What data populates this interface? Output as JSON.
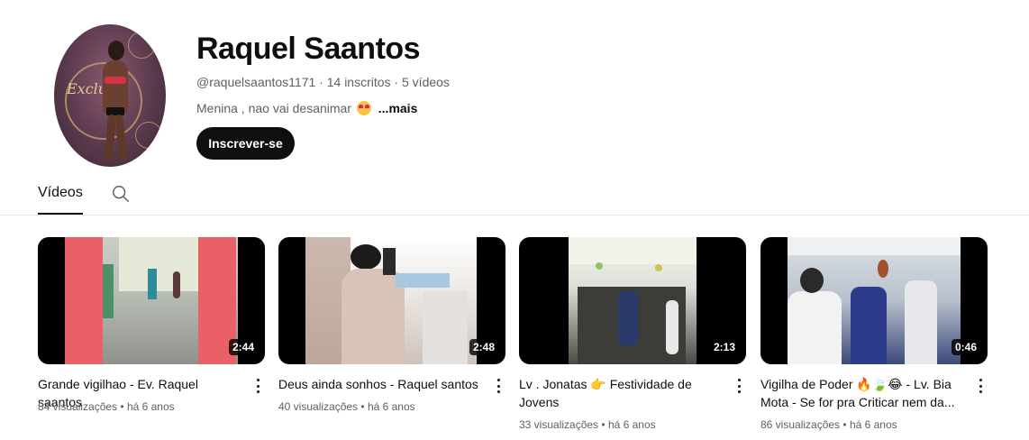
{
  "channel": {
    "name": "Raquel Saantos",
    "handle": "@raquelsaantos1171",
    "subscribers": "14 inscritos",
    "video_count": "5 vídeos",
    "separator": " · ",
    "description": "Menina , nao vai desanimar",
    "description_emoji": "star-struck-emoji",
    "more_label": "...mais",
    "subscribe_label": "Inscrever-se",
    "avatar_text": "Exclu"
  },
  "tabs": {
    "videos_label": "Vídeos",
    "search_icon": "search-icon"
  },
  "videos": [
    {
      "title": "Grande vigilhao - Ev. Raquel saantos",
      "views": "84 visualizações",
      "age": "há 6 anos",
      "duration": "2:44"
    },
    {
      "title": "Deus ainda sonhos - Raquel santos",
      "views": "40 visualizações",
      "age": "há 6 anos",
      "duration": "2:48"
    },
    {
      "title": "Lv . Jonatas 👉 Festividade de Jovens",
      "views": "33 visualizações",
      "age": "há 6 anos",
      "duration": "2:13"
    },
    {
      "title": "Vigilha de Poder 🔥🍃😂 - Lv. Bia Mota - Se for pra Criticar nem da...",
      "views": "86 visualizações",
      "age": "há 6 anos",
      "duration": "0:46"
    }
  ],
  "colors": {
    "text_primary": "#0f0f0f",
    "text_secondary": "#606060",
    "button_bg": "#0f0f0f",
    "divider": "#e5e5e5"
  }
}
